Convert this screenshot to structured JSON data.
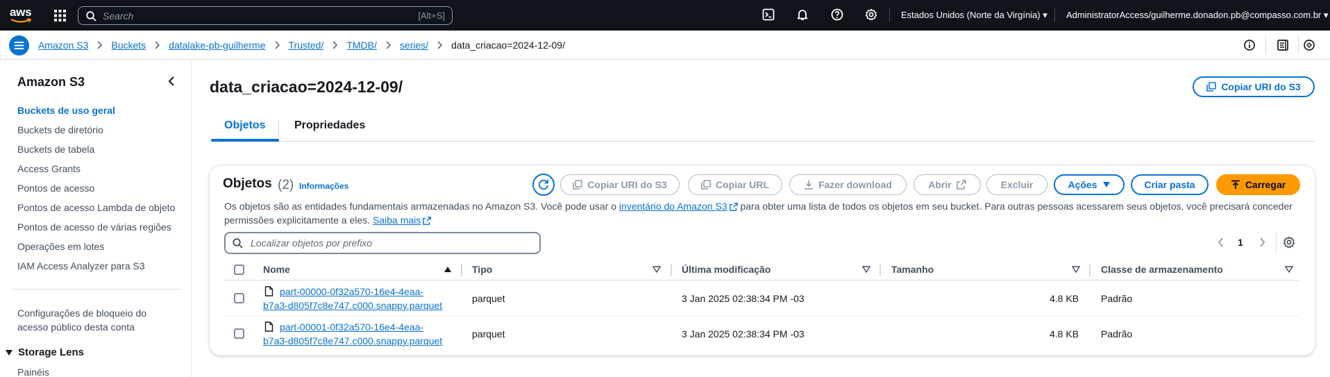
{
  "topnav": {
    "logo_text": "aws",
    "search_placeholder": "Search",
    "search_shortcut": "[Alt+S]",
    "region": "Estados Unidos (Norte da Virgínia)",
    "account": "AdministratorAccess/guilherme.donadon.pb@compasso.com.br",
    "icons": [
      "cloudshell-icon",
      "bell-icon",
      "help-icon",
      "gear-icon"
    ]
  },
  "breadcrumb": {
    "items": [
      "Amazon S3",
      "Buckets",
      "datalake-pb-guilherme",
      "Trusted/",
      "TMDB/",
      "series/"
    ],
    "current": "data_criacao=2024-12-09/"
  },
  "sidebar": {
    "title": "Amazon S3",
    "items": [
      "Buckets de uso geral",
      "Buckets de diretório",
      "Buckets de tabela",
      "Access Grants",
      "Pontos de acesso",
      "Pontos de acesso Lambda de objeto",
      "Pontos de acesso de várias regiões",
      "Operações em lotes",
      "IAM Access Analyzer para S3"
    ],
    "block_public_line1": "Configurações de bloqueio do",
    "block_public_line2": "acesso público desta conta",
    "section_storage_lens": "Storage Lens",
    "section_item": "Painéis"
  },
  "page": {
    "title": "data_criacao=2024-12-09/",
    "copy_uri_button": "Copiar URI do S3"
  },
  "tabs": [
    "Objetos",
    "Propriedades"
  ],
  "objects": {
    "title": "Objetos",
    "count": "(2)",
    "info_link": "Informações",
    "buttons": {
      "copy_uri": "Copiar URI do S3",
      "copy_url": "Copiar URL",
      "download": "Fazer download",
      "open": "Abrir",
      "delete": "Excluir",
      "actions": "Ações",
      "create_folder": "Criar pasta",
      "upload": "Carregar"
    },
    "desc_part1": "Os objetos são as entidades fundamentais armazenadas no Amazon S3. Você pode usar o ",
    "desc_link1": "inventário do Amazon S3",
    "desc_part2": " para obter uma lista de todos os objetos em seu bucket. Para outras pessoas acessarem seus objetos, você precisará conceder permissões explicitamente a eles. ",
    "desc_link2": "Saiba mais",
    "filter_placeholder": "Localizar objetos por prefixo",
    "page_number": "1",
    "columns": [
      "Nome",
      "Tipo",
      "Última modificação",
      "Tamanho",
      "Classe de armazenamento"
    ],
    "rows": [
      {
        "name_line1": "part-00000-0f32a570-16e4-4eaa-",
        "name_line2": "b7a3-d805f7c8e747.c000.snappy.parquet",
        "type": "parquet",
        "modified": "3 Jan 2025 02:38:34 PM -03",
        "size": "4.8 KB",
        "storage_class": "Padrão"
      },
      {
        "name_line1": "part-00001-0f32a570-16e4-4eaa-",
        "name_line2": "b7a3-d805f7c8e747.c000.snappy.parquet",
        "type": "parquet",
        "modified": "3 Jan 2025 02:38:34 PM -03",
        "size": "4.8 KB",
        "storage_class": "Padrão"
      }
    ]
  }
}
